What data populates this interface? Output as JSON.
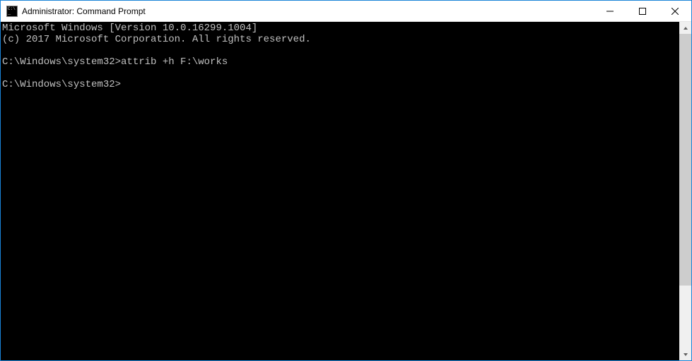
{
  "window": {
    "title": "Administrator: Command Prompt"
  },
  "terminal": {
    "lines": [
      "Microsoft Windows [Version 10.0.16299.1004]",
      "(c) 2017 Microsoft Corporation. All rights reserved.",
      "",
      "C:\\Windows\\system32>attrib +h F:\\works",
      "",
      "C:\\Windows\\system32>"
    ]
  }
}
